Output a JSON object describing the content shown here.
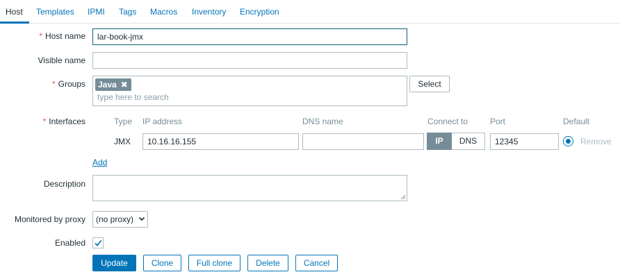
{
  "tabs": [
    "Host",
    "Templates",
    "IPMI",
    "Tags",
    "Macros",
    "Inventory",
    "Encryption"
  ],
  "form": {
    "required_mark": "*",
    "host_name": {
      "label": "Host name",
      "value": "lar-book-jmx"
    },
    "visible_name": {
      "label": "Visible name",
      "value": ""
    },
    "groups": {
      "label": "Groups",
      "chips": [
        "Java"
      ],
      "placeholder": "type here to search",
      "select_button": "Select"
    },
    "interfaces": {
      "label": "Interfaces",
      "columns": [
        "Type",
        "IP address",
        "DNS name",
        "Connect to",
        "Port",
        "Default"
      ],
      "row": {
        "type": "JMX",
        "ip": "10.16.16.155",
        "dns": "",
        "connect_options": [
          "IP",
          "DNS"
        ],
        "connect_selected": "IP",
        "port": "12345",
        "default": true,
        "remove_label": "Remove"
      },
      "add_label": "Add"
    },
    "description": {
      "label": "Description",
      "value": ""
    },
    "proxy": {
      "label": "Monitored by proxy",
      "value": "(no proxy)"
    },
    "enabled": {
      "label": "Enabled",
      "checked": true
    }
  },
  "buttons": {
    "update": "Update",
    "clone": "Clone",
    "full_clone": "Full clone",
    "delete": "Delete",
    "cancel": "Cancel"
  },
  "colors": {
    "link": "#0275b8",
    "required": "#e45959",
    "chip": "#768d99",
    "border": "#acbbc2"
  }
}
